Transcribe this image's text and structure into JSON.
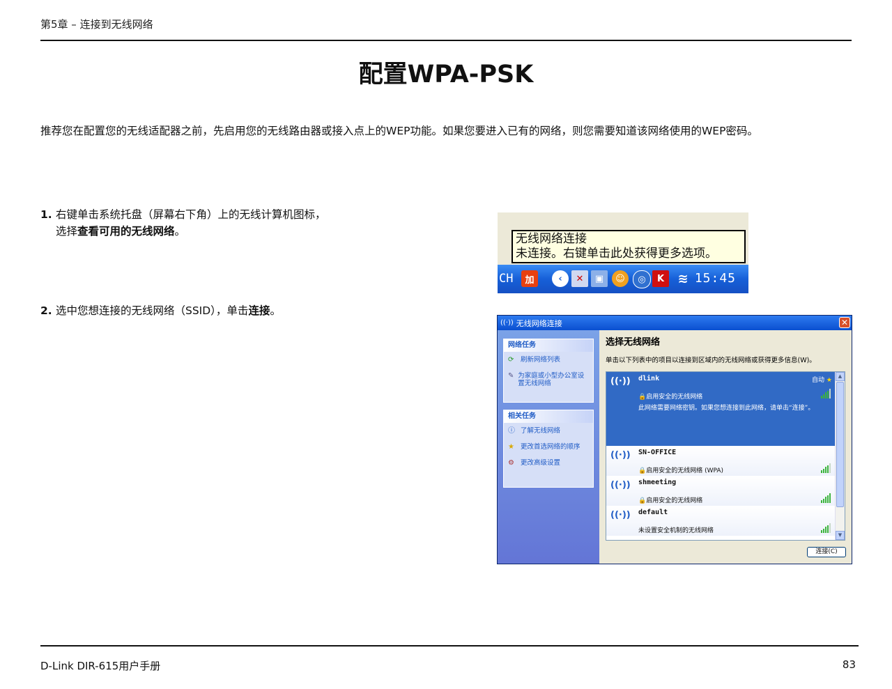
{
  "header": {
    "chapter": "第5章 – 连接到无线网络"
  },
  "title": "配置WPA-PSK",
  "intro": "推荐您在配置您的无线适配器之前，先启用您的无线路由器或接入点上的WEP功能。如果您要进入已有的网络，则您需要知道该网络使用的WEP密码。",
  "steps": [
    {
      "num": "1.",
      "line1": "右键单击系统托盘（屏幕右下角）上的无线计算机图标，",
      "line2_pre": "选择",
      "line2_bold": "查看可用的无线网络",
      "line2_post": "。"
    },
    {
      "num": "2.",
      "text_pre": "选中您想连接的无线网络（SSID），单击",
      "text_bold": "连接",
      "text_post": "。"
    }
  ],
  "tray": {
    "tooltip_line1": "无线网络连接",
    "tooltip_line2": "未连接。右键单击此处获得更多选项。",
    "lang": "CH",
    "clock": "15:45"
  },
  "dialog": {
    "title": "无线网络连接",
    "network_tasks": {
      "heading": "网络任务",
      "items": [
        "刷新网络列表",
        "为家庭或小型办公室设置无线网络"
      ]
    },
    "related_tasks": {
      "heading": "相关任务",
      "items": [
        "了解无线网络",
        "更改首选网络的顺序",
        "更改高级设置"
      ]
    },
    "right_heading": "选择无线网络",
    "right_desc": "单击以下列表中的项目以连接到区域内的无线网络或获得更多信息(W)。",
    "networks": [
      {
        "ssid": "dlink",
        "security": "启用安全的无线网络",
        "auto": "自动",
        "detail": "此网络需要网络密钥。如果您想连接到此网络，请单击“连接”。",
        "signal": 0.8
      },
      {
        "ssid": "SN-OFFICE",
        "security": "启用安全的无线网络 (WPA)",
        "signal": 0.8
      },
      {
        "ssid": "shmeeting",
        "security": "启用安全的无线网络",
        "signal": 1.0
      },
      {
        "ssid": "default",
        "security": "未设置安全机制的无线网络",
        "signal": 0.8
      }
    ],
    "connect_button": "连接(C)"
  },
  "footer": {
    "left": "D-Link DIR-615用户手册",
    "page": "83"
  }
}
